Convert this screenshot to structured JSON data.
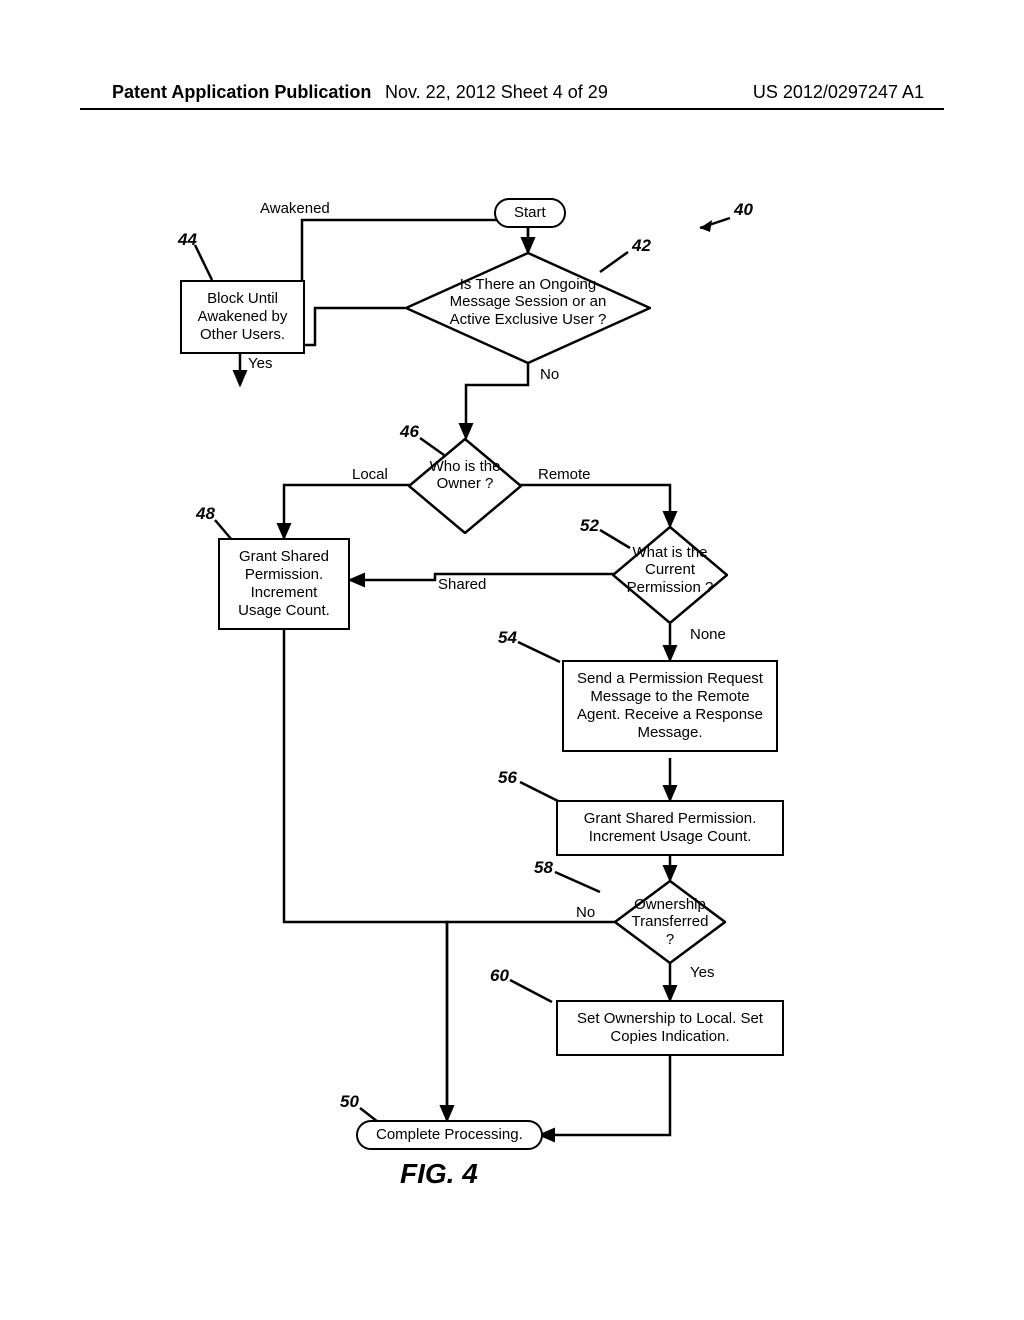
{
  "header": {
    "left": "Patent Application Publication",
    "mid": "Nov. 22, 2012  Sheet 4 of 29",
    "right": "US 2012/0297247 A1"
  },
  "flowchart": {
    "start": "Start",
    "d42": "Is There an Ongoing Message Session or an Active Exclusive User ?",
    "p44": "Block Until Awakened by Other Users.",
    "awakened": "Awakened",
    "d46": "Who is the Owner ?",
    "p48": "Grant Shared Permission. Increment Usage Count.",
    "d52": "What is the Current Permission ?",
    "p54": "Send a Permission Request Message to the Remote Agent. Receive a Response Message.",
    "p56": "Grant Shared Permission. Increment Usage Count.",
    "d58": "Ownership Transferred ?",
    "p60": "Set Ownership to Local. Set Copies Indication.",
    "end": "Complete Processing."
  },
  "branches": {
    "yes42": "Yes",
    "no42": "No",
    "local": "Local",
    "remote": "Remote",
    "shared": "Shared",
    "none": "None",
    "no58": "No",
    "yes58": "Yes"
  },
  "refs": {
    "r40": "40",
    "r42": "42",
    "r44": "44",
    "r46": "46",
    "r48": "48",
    "r50": "50",
    "r52": "52",
    "r54": "54",
    "r56": "56",
    "r58": "58",
    "r60": "60"
  },
  "figure": "FIG.   4"
}
